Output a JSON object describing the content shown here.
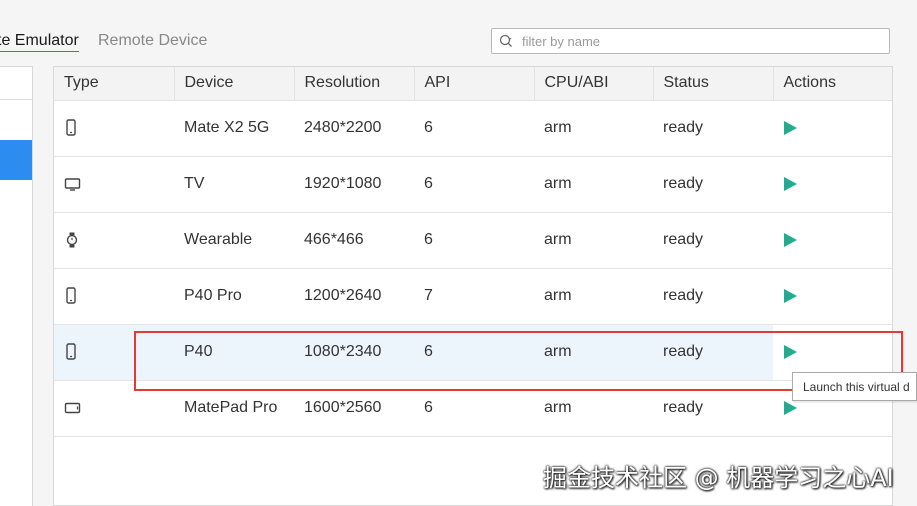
{
  "tabs": {
    "active_label": "te Emulator",
    "inactive_label": "Remote Device"
  },
  "search": {
    "placeholder": "filter by name",
    "value": ""
  },
  "table": {
    "headers": [
      "Type",
      "Device",
      "Resolution",
      "API",
      "CPU/ABI",
      "Status",
      "Actions"
    ],
    "rows": [
      {
        "type_icon": "phone-icon",
        "device": "Mate X2 5G",
        "resolution": "2480*2200",
        "api": "6",
        "cpu": "arm",
        "status": "ready",
        "action_icon": "play-icon"
      },
      {
        "type_icon": "tv-icon",
        "device": "TV",
        "resolution": "1920*1080",
        "api": "6",
        "cpu": "arm",
        "status": "ready",
        "action_icon": "play-icon"
      },
      {
        "type_icon": "watch-icon",
        "device": "Wearable",
        "resolution": "466*466",
        "api": "6",
        "cpu": "arm",
        "status": "ready",
        "action_icon": "play-icon"
      },
      {
        "type_icon": "phone-icon",
        "device": "P40 Pro",
        "resolution": "1200*2640",
        "api": "7",
        "cpu": "arm",
        "status": "ready",
        "action_icon": "play-icon"
      },
      {
        "type_icon": "phone-icon",
        "device": "P40",
        "resolution": "1080*2340",
        "api": "6",
        "cpu": "arm",
        "status": "ready",
        "action_icon": "play-icon"
      },
      {
        "type_icon": "tablet-icon",
        "device": "MatePad Pro",
        "resolution": "1600*2560",
        "api": "6",
        "cpu": "arm",
        "status": "ready",
        "action_icon": "play-icon"
      }
    ]
  },
  "tooltip": {
    "text": "Launch this virtual d"
  },
  "watermark": {
    "text": "掘金技术社区 @ 机器学习之心AI"
  },
  "colors": {
    "accent": "#2d8cf0",
    "play": "#25a98f",
    "highlight": "#e53935",
    "hover_row": "#edf5fc"
  }
}
